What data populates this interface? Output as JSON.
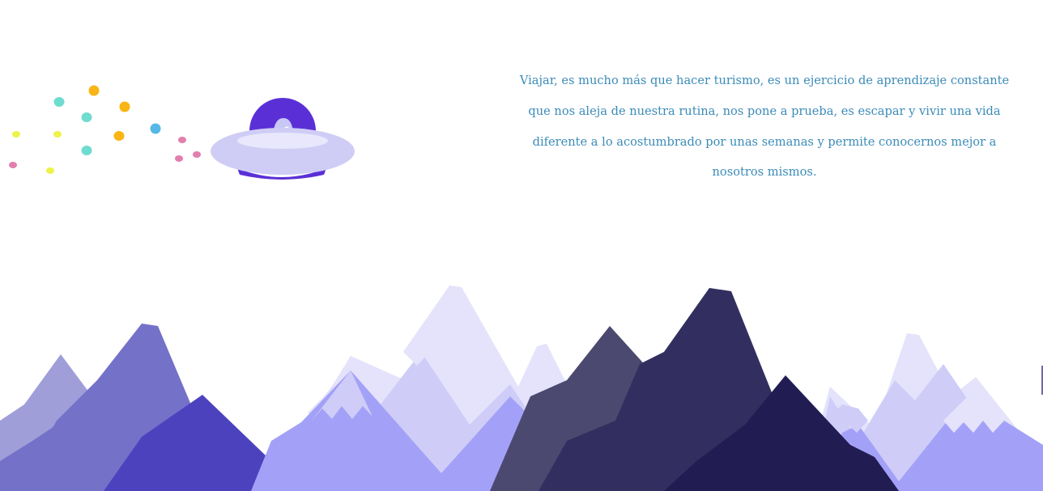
{
  "intro": {
    "text": "Viajar, es mucho más que hacer turismo, es un ejercicio de aprendizaje constante que nos aleja de nuestra rutina, nos pone a prueba, es escapar y vivir una vida diferente a lo acostumbrado por unas semanas y permite conocernos mejor a nosotros mismos."
  },
  "colors": {
    "text": "#3b8bb8",
    "ufo_dome": "#5a30d6",
    "ufo_disc": "#cfcdf5",
    "mountain_light": "#cfcdf8",
    "mountain_dark": "#211c52"
  },
  "icons": {
    "ufo": "ufo-icon",
    "alien": "alien-icon"
  }
}
